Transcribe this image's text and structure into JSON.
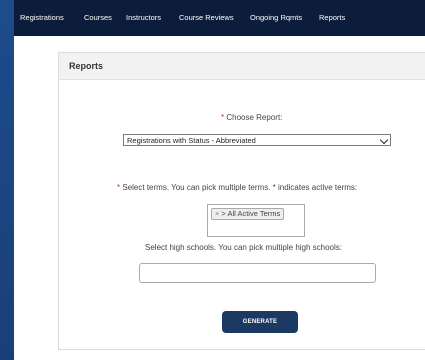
{
  "nav": {
    "items": [
      "Registrations",
      "Courses",
      "Instructors",
      "Course Reviews",
      "Ongoing Rqmts",
      "Reports"
    ]
  },
  "panel": {
    "title": "Reports"
  },
  "report": {
    "required_mark": "*",
    "label": "Choose Report:",
    "selected": "Registrations with Status - Abbreviated"
  },
  "terms": {
    "required_mark": "*",
    "label": "Select terms. You can pick multiple terms. * indicates active terms:",
    "tag_remove": "×",
    "tag_label": "> All Active Terms"
  },
  "high_schools": {
    "label": "Select high schools. You can pick multiple high schools:",
    "value": ""
  },
  "generate_label": "GENERATE"
}
